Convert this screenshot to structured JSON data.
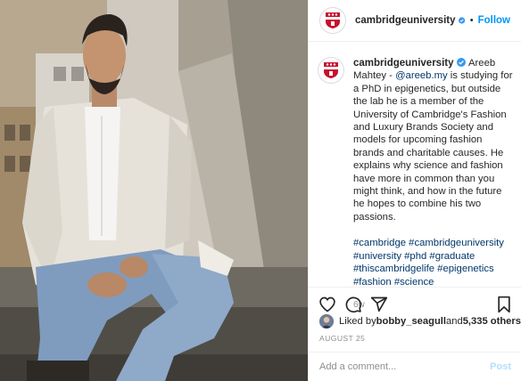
{
  "account": {
    "username": "cambridgeuniversity",
    "verified": true,
    "follow_label": "Follow",
    "separator": "•"
  },
  "caption": {
    "username": "cambridgeuniversity",
    "text_before_mention": "Areeb Mahtey - ",
    "mention": "@areeb.my",
    "text_after_mention": " is studying for a PhD in epigenetics, but outside the lab he is a member of the University of Cambridge's Fashion and Luxury Brands Society and models for upcoming fashion brands and charitable causes. He explains why science and fashion have more in common than you might think, and how in the future he hopes to combine his two passions.",
    "hashtags": "#cambridge #cambridgeuniversity #university #phd #graduate #thiscambridgelife #epigenetics #fashion #science",
    "age": "6w"
  },
  "likes": {
    "prefix": "Liked by ",
    "user": "bobby_seagull",
    "middle": " and ",
    "count": "5,335 others"
  },
  "date": "AUGUST 25",
  "comment": {
    "placeholder": "Add a comment...",
    "post_label": "Post"
  },
  "icons": {
    "like": "heart-icon",
    "comment": "comment-icon",
    "share": "share-icon",
    "save": "bookmark-icon",
    "verified": "verified-badge-icon"
  },
  "colors": {
    "link": "#0095f6",
    "hashtag": "#00376b",
    "muted": "#8e8e8e",
    "post_disabled": "#b2dffc",
    "crest_red": "#c8102e"
  }
}
